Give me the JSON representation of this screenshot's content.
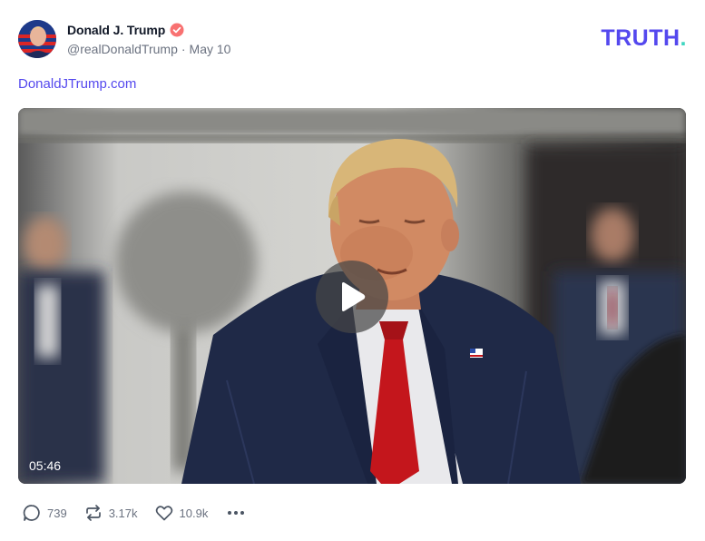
{
  "post": {
    "author": {
      "display_name": "Donald J. Trump",
      "handle": "@realDonaldTrump",
      "date": "May 10",
      "separator": "·",
      "verified_icon": "verified-badge-icon"
    },
    "brand": {
      "logo_text": "TRUTH",
      "logo_dot": ".",
      "color": "#5448ee",
      "dot_color": "#3ed6c0"
    },
    "link_text": "DonaldJTrump.com",
    "video": {
      "duration": "05:46",
      "play_icon": "play-icon"
    },
    "actions": {
      "replies": "739",
      "retruths": "3.17k",
      "likes": "10.9k",
      "more_icon": "more-icon"
    }
  }
}
